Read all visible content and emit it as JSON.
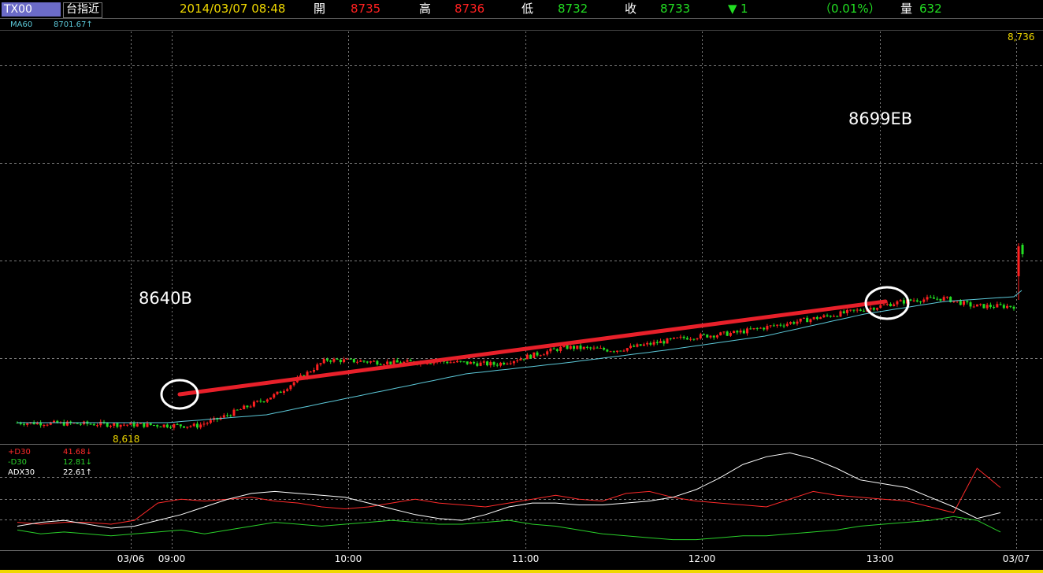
{
  "header": {
    "symbol": "TX00",
    "symbol_name": "台指近",
    "datetime": "2014/03/07 08:48",
    "open_label": "開",
    "open_value": "8735",
    "high_label": "高",
    "high_value": "8736",
    "low_label": "低",
    "low_value": "8732",
    "close_label": "收",
    "close_value": "8733",
    "change_arrow": "▼",
    "change_value": "1",
    "change_pct": "（0.01%）",
    "volume_label": "量",
    "volume_value": "632"
  },
  "indicator": {
    "name": "MA60",
    "value": "8701.67↑"
  },
  "dmi": [
    {
      "name": "+D30",
      "value": "41.68↓"
    },
    {
      "name": "-D30",
      "value": "12.81↓"
    },
    {
      "name": "ADX30",
      "value": "22.61↑"
    }
  ],
  "annotations": {
    "buy_label": "8640B",
    "exit_label": "8699EB"
  },
  "colors": {
    "up": "#ff2020",
    "down": "#22dd22",
    "ma": "#5cc8d8",
    "trendline": "#e8202a",
    "grid": "#7a7a7a",
    "yellow": "#f0d800",
    "plus_di": "#ff2a2a",
    "minus_di": "#2ad02a",
    "adx": "#ffffff"
  },
  "chart_data": {
    "type": "candlestick",
    "title": "TX00 台指近",
    "x_ticks": [
      "03/06",
      "09:00",
      "10:00",
      "11:00",
      "12:00",
      "13:00",
      "03/07"
    ],
    "price_labels": {
      "max": "8,736",
      "min": "8,618"
    },
    "price_anchors": [
      {
        "t": 0,
        "price": 8622
      },
      {
        "t": 0.18,
        "price": 8620
      },
      {
        "t": 0.2,
        "price": 8624
      },
      {
        "t": 0.26,
        "price": 8640
      },
      {
        "t": 0.31,
        "price": 8662
      },
      {
        "t": 0.38,
        "price": 8660
      },
      {
        "t": 0.42,
        "price": 8661
      },
      {
        "t": 0.48,
        "price": 8659
      },
      {
        "t": 0.55,
        "price": 8670
      },
      {
        "t": 0.6,
        "price": 8668
      },
      {
        "t": 0.67,
        "price": 8676
      },
      {
        "t": 0.72,
        "price": 8679
      },
      {
        "t": 0.78,
        "price": 8686
      },
      {
        "t": 0.85,
        "price": 8694
      },
      {
        "t": 0.88,
        "price": 8698
      },
      {
        "t": 0.9,
        "price": 8700
      },
      {
        "t": 0.93,
        "price": 8701
      },
      {
        "t": 0.96,
        "price": 8696
      },
      {
        "t": 1.0,
        "price": 8696
      }
    ],
    "last_price": 8733,
    "ma60_anchors": [
      {
        "t": 0,
        "price": 8622
      },
      {
        "t": 0.15,
        "price": 8622
      },
      {
        "t": 0.25,
        "price": 8627
      },
      {
        "t": 0.35,
        "price": 8640
      },
      {
        "t": 0.45,
        "price": 8653
      },
      {
        "t": 0.55,
        "price": 8660
      },
      {
        "t": 0.65,
        "price": 8668
      },
      {
        "t": 0.75,
        "price": 8677
      },
      {
        "t": 0.85,
        "price": 8691
      },
      {
        "t": 0.93,
        "price": 8699
      },
      {
        "t": 1.0,
        "price": 8702
      }
    ],
    "trendline": {
      "start_price": 8640,
      "end_price": 8699
    },
    "dmi_series": {
      "plus_di": [
        12,
        11,
        12,
        12,
        11,
        13,
        22,
        24,
        23,
        24,
        25,
        23,
        22,
        20,
        19,
        20,
        22,
        24,
        22,
        21,
        20,
        22,
        24,
        26,
        24,
        23,
        27,
        28,
        25,
        23,
        22,
        21,
        20,
        24,
        28,
        26,
        25,
        24,
        23,
        20,
        17,
        40,
        30
      ],
      "minus_di": [
        8,
        6,
        7,
        6,
        5,
        6,
        7,
        8,
        6,
        8,
        10,
        12,
        11,
        10,
        11,
        12,
        13,
        12,
        11,
        11,
        12,
        13,
        11,
        10,
        8,
        6,
        5,
        4,
        3,
        3,
        4,
        5,
        5,
        6,
        7,
        8,
        10,
        11,
        12,
        13,
        15,
        13,
        7
      ],
      "adx": [
        10,
        12,
        13,
        11,
        9,
        10,
        13,
        16,
        20,
        24,
        27,
        28,
        27,
        26,
        25,
        22,
        19,
        16,
        14,
        13,
        16,
        20,
        22,
        22,
        21,
        21,
        22,
        23,
        25,
        29,
        35,
        42,
        46,
        48,
        45,
        40,
        34,
        32,
        30,
        25,
        20,
        14,
        17
      ]
    }
  }
}
